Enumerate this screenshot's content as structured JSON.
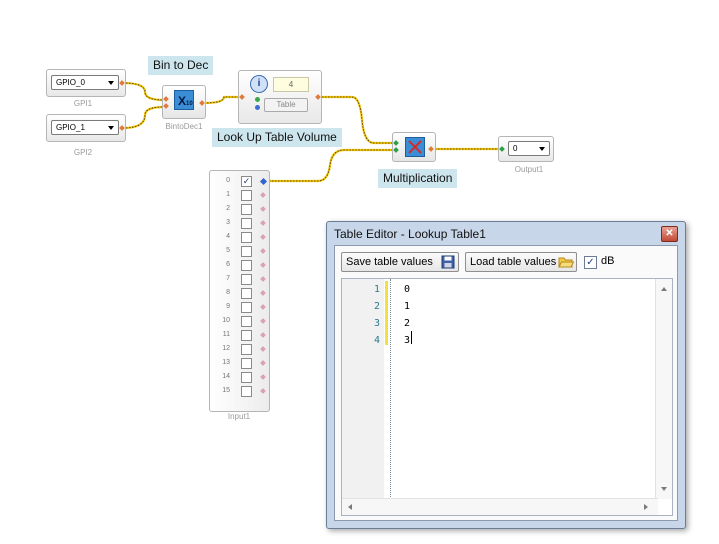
{
  "nodes": {
    "gpio0": {
      "value": "GPIO_0",
      "caption": "GPI1"
    },
    "gpio1": {
      "value": "GPIO_1",
      "caption": "GPI2"
    },
    "bin_to_dec": {
      "tag": "Bin to Dec",
      "caption": "BintoDec1",
      "icon_text": "X",
      "icon_sub": "10"
    },
    "lookup": {
      "tag": "Look Up Table Volume",
      "value": "4",
      "table_button": "Table"
    },
    "multiplication": {
      "tag": "Multiplication"
    },
    "output": {
      "value": "0",
      "caption": "Output1"
    },
    "input": {
      "caption": "Input1",
      "rows": [
        {
          "n": "0",
          "checked": true
        },
        {
          "n": "1",
          "checked": false
        },
        {
          "n": "2",
          "checked": false
        },
        {
          "n": "3",
          "checked": false
        },
        {
          "n": "4",
          "checked": false
        },
        {
          "n": "5",
          "checked": false
        },
        {
          "n": "6",
          "checked": false
        },
        {
          "n": "7",
          "checked": false
        },
        {
          "n": "8",
          "checked": false
        },
        {
          "n": "9",
          "checked": false
        },
        {
          "n": "10",
          "checked": false
        },
        {
          "n": "11",
          "checked": false
        },
        {
          "n": "12",
          "checked": false
        },
        {
          "n": "13",
          "checked": false
        },
        {
          "n": "14",
          "checked": false
        },
        {
          "n": "15",
          "checked": false
        }
      ]
    }
  },
  "editor": {
    "title": "Table Editor - Lookup Table1",
    "save_label": "Save table values",
    "load_label": "Load table values",
    "db_label": "dB",
    "db_checked": true,
    "lines": [
      {
        "num": "1",
        "text": "0"
      },
      {
        "num": "2",
        "text": "1"
      },
      {
        "num": "3",
        "text": "2"
      },
      {
        "num": "4",
        "text": "3"
      }
    ]
  },
  "colors": {
    "wire": "#f2c200",
    "tag_bg": "#cde6ee",
    "window_frame": "#c7d6e8"
  }
}
